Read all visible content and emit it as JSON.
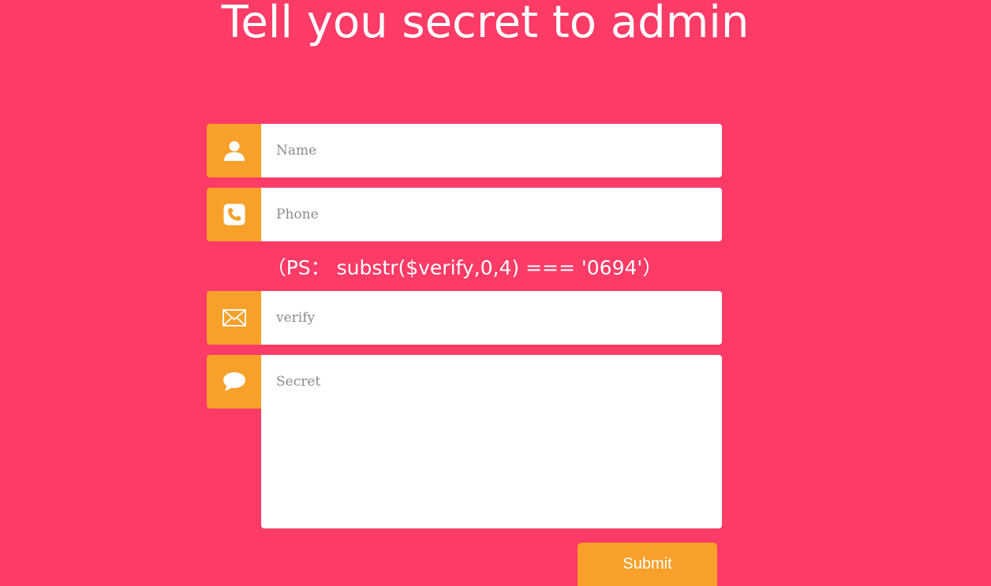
{
  "page": {
    "title": "Tell you secret to admin"
  },
  "form": {
    "name_placeholder": "Name",
    "phone_placeholder": "Phone",
    "hint": "（PS： substr($verify,0,4) === '0694'）",
    "verify_placeholder": "verify",
    "secret_placeholder": "Secret",
    "submit_label": "Submit"
  },
  "icons": {
    "name": "user-icon",
    "phone": "phone-icon",
    "verify": "envelope-icon",
    "secret": "speech-bubble-icon"
  },
  "colors": {
    "background": "#fc3b66",
    "accent": "#f7a02a",
    "field": "#ffffff"
  }
}
